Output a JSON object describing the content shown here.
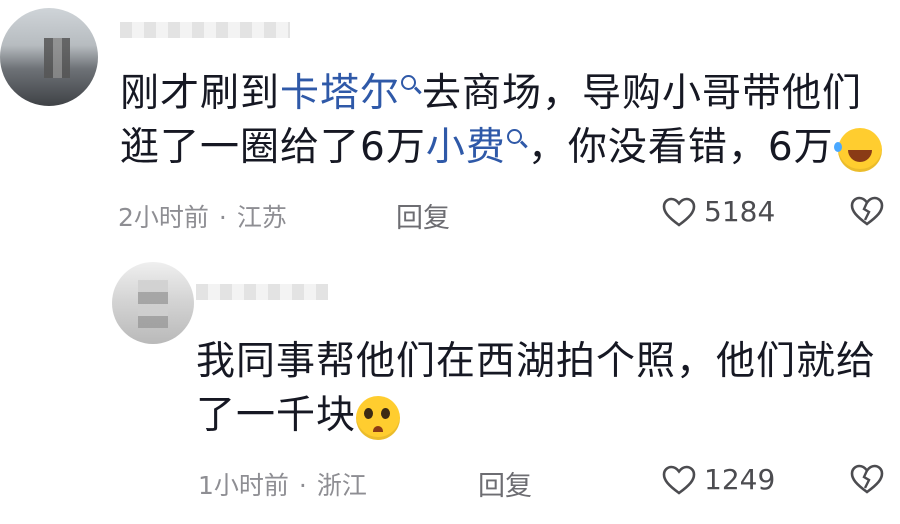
{
  "comment1": {
    "line1_before": "刚才刷到",
    "link1": "卡塔尔",
    "line1_after": "去商场，导购小哥带他们",
    "line2_before": "逛了一圈给了6万",
    "link2": "小费",
    "line2_after": "，你没看错，6万",
    "emoji": "laughing-crying-emoji",
    "time": "2小时前",
    "location": "江苏",
    "reply_label": "回复",
    "likes": "5184"
  },
  "comment2": {
    "line1": "我同事帮他们在西湖拍个照，他们就给",
    "line2": "了一千块",
    "emoji": "pleading-tears-emoji",
    "time": "1小时前",
    "location": "浙江",
    "reply_label": "回复",
    "likes": "1249"
  },
  "meta_separator": "·"
}
